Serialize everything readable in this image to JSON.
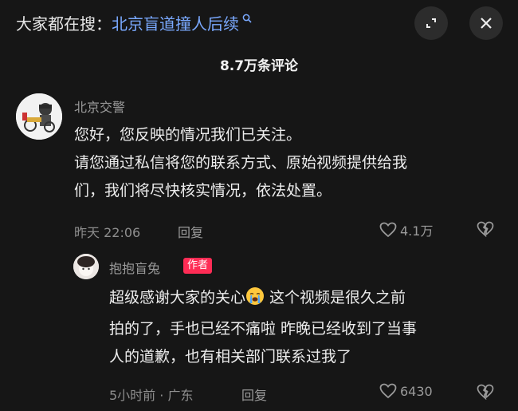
{
  "header": {
    "search_prefix": "大家都在搜：",
    "search_term": "北京盲道撞人后续",
    "search_icon": "search-icon",
    "expand_icon": "expand-icon",
    "close_icon": "close-icon"
  },
  "comments_title": "8.7万条评论",
  "comments": [
    {
      "username": "北京交警",
      "lines": [
        "您好，您反映的情况我们已关注。",
        "请您通过私信将您的联系方式、原始视频提供给我",
        "们，我们将尽快核实情况，依法处置。"
      ],
      "time": "昨天 22:06",
      "reply_label": "回复",
      "likes": "4.1万"
    },
    {
      "username": "抱抱盲兔",
      "author_tag": "作者",
      "line1_a": "超级感谢大家的关心",
      "line1_b": " 这个视频是很久之前",
      "lines_rest": [
        "拍的了，手也已经不痛啦 昨晚已经收到了当事",
        "人的道歉，也有相关部门联系过我了"
      ],
      "emoji": "crying-face-emoji",
      "time": "5小时前 · 广东",
      "reply_label": "回复",
      "likes": "6430"
    }
  ]
}
